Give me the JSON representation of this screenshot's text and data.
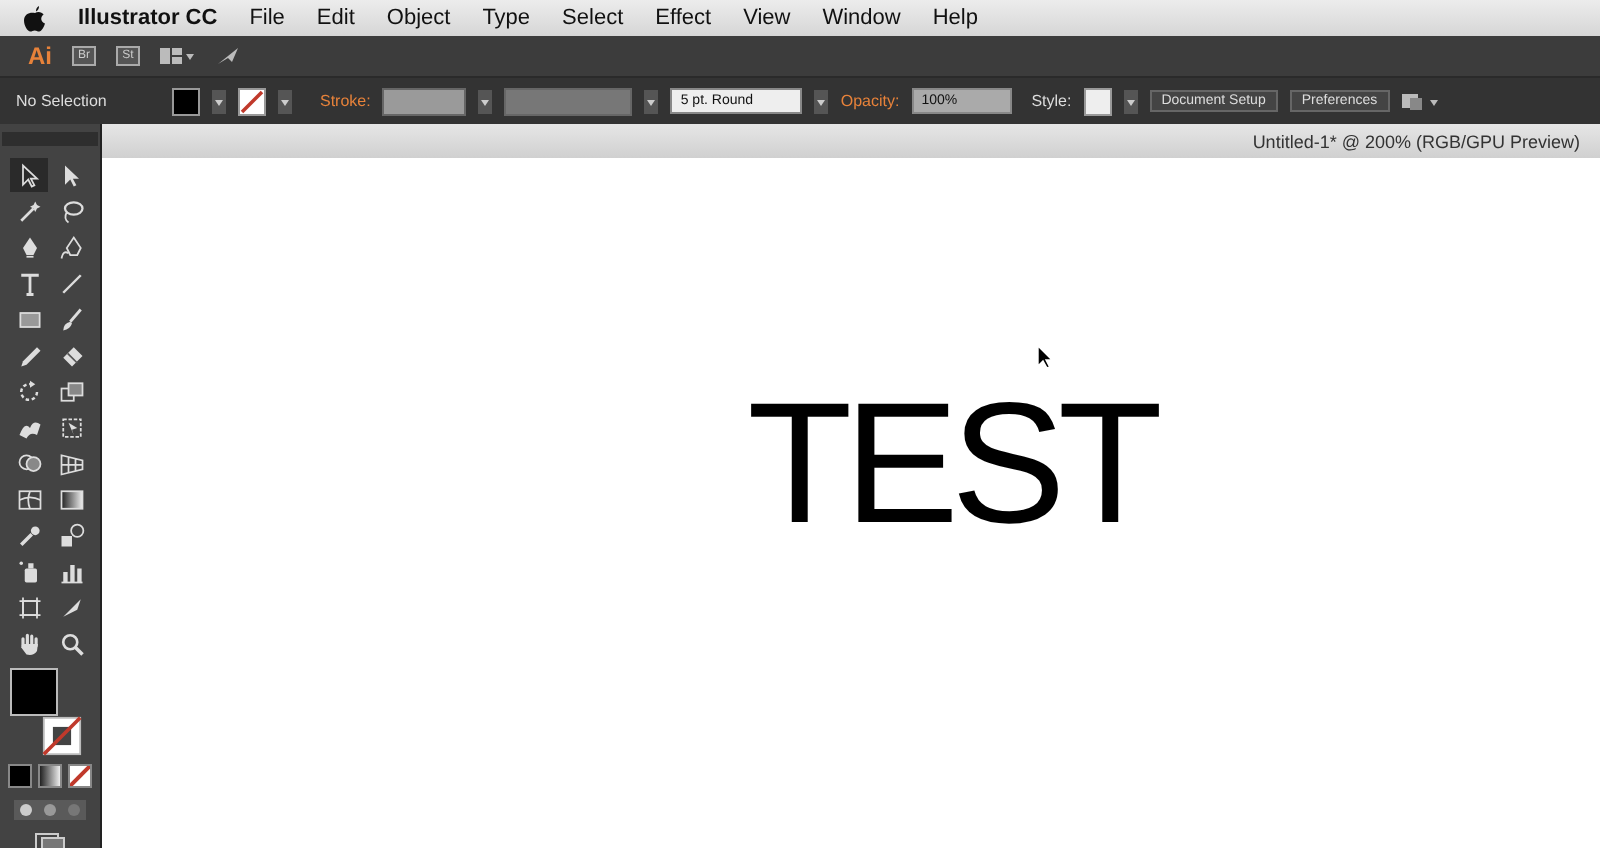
{
  "menu_bar": {
    "app_name": "Illustrator CC",
    "items": [
      "File",
      "Edit",
      "Object",
      "Type",
      "Select",
      "Effect",
      "View",
      "Window",
      "Help"
    ]
  },
  "app_bar": {
    "logo": "Ai",
    "buttons": [
      {
        "label": "Br"
      },
      {
        "label": "St"
      }
    ]
  },
  "control_bar": {
    "selection": "No Selection",
    "stroke_label": "Stroke:",
    "brush": "5 pt. Round",
    "opacity_label": "Opacity:",
    "opacity": "100%",
    "style_label": "Style:",
    "buttons": [
      "Document Setup",
      "Preferences"
    ]
  },
  "document": {
    "tab_title": "Untitled-1* @ 200% (RGB/GPU Preview)",
    "text": "TEST"
  },
  "tools": [
    {
      "kind": "selection",
      "selected": true
    },
    {
      "kind": "direct",
      "selected": false
    },
    {
      "kind": "wand",
      "selected": false
    },
    {
      "kind": "lasso",
      "selected": false
    },
    {
      "kind": "pen",
      "selected": false
    },
    {
      "kind": "curvature",
      "selected": false
    },
    {
      "kind": "type",
      "selected": false
    },
    {
      "kind": "line",
      "selected": false
    },
    {
      "kind": "rect",
      "selected": false
    },
    {
      "kind": "brush",
      "selected": false
    },
    {
      "kind": "pencil",
      "selected": false
    },
    {
      "kind": "eraser",
      "selected": false
    },
    {
      "kind": "rotate",
      "selected": false
    },
    {
      "kind": "scale",
      "selected": false
    },
    {
      "kind": "warp",
      "selected": false
    },
    {
      "kind": "freetransform",
      "selected": false
    },
    {
      "kind": "shapebuilder",
      "selected": false
    },
    {
      "kind": "perspective",
      "selected": false
    },
    {
      "kind": "mesh",
      "selected": false
    },
    {
      "kind": "gradient",
      "selected": false
    },
    {
      "kind": "eyedropper",
      "selected": false
    },
    {
      "kind": "blend",
      "selected": false
    },
    {
      "kind": "symbol",
      "selected": false
    },
    {
      "kind": "graph",
      "selected": false
    },
    {
      "kind": "artboard",
      "selected": false
    },
    {
      "kind": "slice",
      "selected": false
    },
    {
      "kind": "hand",
      "selected": false
    },
    {
      "kind": "zoom",
      "selected": false
    }
  ]
}
